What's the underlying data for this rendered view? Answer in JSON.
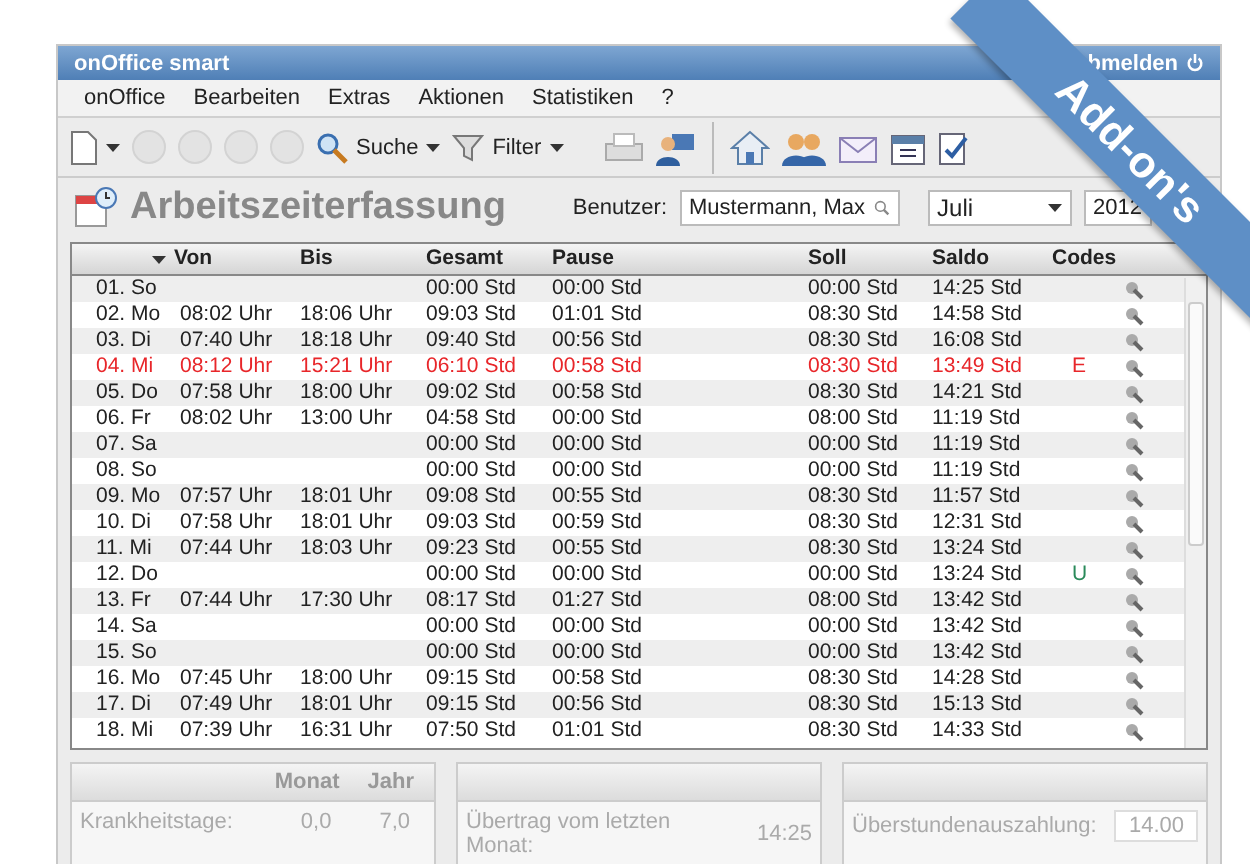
{
  "window": {
    "title": "onOffice smart",
    "logout": "bmelden"
  },
  "menu": [
    "onOffice",
    "Bearbeiten",
    "Extras",
    "Aktionen",
    "Statistiken",
    "?"
  ],
  "toolbar": {
    "search": "Suche",
    "filter": "Filter"
  },
  "header": {
    "title": "Arbeitszeiterfassung",
    "user_label": "Benutzer:",
    "user": "Mustermann, Max",
    "month": "Juli",
    "year": "2012"
  },
  "table": {
    "columns": [
      "Von",
      "Bis",
      "Gesamt",
      "Pause",
      "Soll",
      "Saldo",
      "Codes"
    ],
    "rows": [
      {
        "day": "01. So",
        "von": "",
        "bis": "",
        "gesamt": "00:00 Std",
        "pause": "00:00 Std",
        "soll": "00:00 Std",
        "saldo": "14:25 Std",
        "code": "",
        "highlighted": false
      },
      {
        "day": "02. Mo",
        "von": "08:02 Uhr",
        "bis": "18:06 Uhr",
        "gesamt": "09:03 Std",
        "pause": "01:01 Std",
        "soll": "08:30 Std",
        "saldo": "14:58 Std",
        "code": "",
        "highlighted": false
      },
      {
        "day": "03. Di",
        "von": "07:40 Uhr",
        "bis": "18:18 Uhr",
        "gesamt": "09:40 Std",
        "pause": "00:56 Std",
        "soll": "08:30 Std",
        "saldo": "16:08 Std",
        "code": "",
        "highlighted": false
      },
      {
        "day": "04. Mi",
        "von": "08:12 Uhr",
        "bis": "15:21 Uhr",
        "gesamt": "06:10 Std",
        "pause": "00:58 Std",
        "soll": "08:30 Std",
        "saldo": "13:49 Std",
        "code": "E",
        "highlighted": true
      },
      {
        "day": "05. Do",
        "von": "07:58 Uhr",
        "bis": "18:00 Uhr",
        "gesamt": "09:02 Std",
        "pause": "00:58 Std",
        "soll": "08:30 Std",
        "saldo": "14:21 Std",
        "code": "",
        "highlighted": false
      },
      {
        "day": "06. Fr",
        "von": "08:02 Uhr",
        "bis": "13:00 Uhr",
        "gesamt": "04:58 Std",
        "pause": "00:00 Std",
        "soll": "08:00 Std",
        "saldo": "11:19 Std",
        "code": "",
        "highlighted": false
      },
      {
        "day": "07. Sa",
        "von": "",
        "bis": "",
        "gesamt": "00:00 Std",
        "pause": "00:00 Std",
        "soll": "00:00 Std",
        "saldo": "11:19 Std",
        "code": "",
        "highlighted": false
      },
      {
        "day": "08. So",
        "von": "",
        "bis": "",
        "gesamt": "00:00 Std",
        "pause": "00:00 Std",
        "soll": "00:00 Std",
        "saldo": "11:19 Std",
        "code": "",
        "highlighted": false
      },
      {
        "day": "09. Mo",
        "von": "07:57 Uhr",
        "bis": "18:01 Uhr",
        "gesamt": "09:08 Std",
        "pause": "00:55 Std",
        "soll": "08:30 Std",
        "saldo": "11:57 Std",
        "code": "",
        "highlighted": false
      },
      {
        "day": "10. Di",
        "von": "07:58 Uhr",
        "bis": "18:01 Uhr",
        "gesamt": "09:03 Std",
        "pause": "00:59 Std",
        "soll": "08:30 Std",
        "saldo": "12:31 Std",
        "code": "",
        "highlighted": false
      },
      {
        "day": "11. Mi",
        "von": "07:44 Uhr",
        "bis": "18:03 Uhr",
        "gesamt": "09:23 Std",
        "pause": "00:55 Std",
        "soll": "08:30 Std",
        "saldo": "13:24 Std",
        "code": "",
        "highlighted": false
      },
      {
        "day": "12. Do",
        "von": "",
        "bis": "",
        "gesamt": "00:00 Std",
        "pause": "00:00 Std",
        "soll": "00:00 Std",
        "saldo": "13:24 Std",
        "code": "U",
        "highlighted": false
      },
      {
        "day": "13. Fr",
        "von": "07:44 Uhr",
        "bis": "17:30 Uhr",
        "gesamt": "08:17 Std",
        "pause": "01:27 Std",
        "soll": "08:00 Std",
        "saldo": "13:42 Std",
        "code": "",
        "highlighted": false
      },
      {
        "day": "14. Sa",
        "von": "",
        "bis": "",
        "gesamt": "00:00 Std",
        "pause": "00:00 Std",
        "soll": "00:00 Std",
        "saldo": "13:42 Std",
        "code": "",
        "highlighted": false
      },
      {
        "day": "15. So",
        "von": "",
        "bis": "",
        "gesamt": "00:00 Std",
        "pause": "00:00 Std",
        "soll": "00:00 Std",
        "saldo": "13:42 Std",
        "code": "",
        "highlighted": false
      },
      {
        "day": "16. Mo",
        "von": "07:45 Uhr",
        "bis": "18:00 Uhr",
        "gesamt": "09:15 Std",
        "pause": "00:58 Std",
        "soll": "08:30 Std",
        "saldo": "14:28 Std",
        "code": "",
        "highlighted": false
      },
      {
        "day": "17. Di",
        "von": "07:49 Uhr",
        "bis": "18:01 Uhr",
        "gesamt": "09:15 Std",
        "pause": "00:56 Std",
        "soll": "08:30 Std",
        "saldo": "15:13 Std",
        "code": "",
        "highlighted": false
      },
      {
        "day": "18. Mi",
        "von": "07:39 Uhr",
        "bis": "16:31 Uhr",
        "gesamt": "07:50 Std",
        "pause": "01:01 Std",
        "soll": "08:30 Std",
        "saldo": "14:33 Std",
        "code": "",
        "highlighted": false
      }
    ]
  },
  "summary": {
    "month_header": "Monat",
    "year_header": "Jahr",
    "sick_label": "Krankheitstage:",
    "sick_month": "0,0",
    "sick_year": "7,0",
    "carry_label": "Übertrag vom letzten Monat:",
    "carry_value": "14:25",
    "payout_label": "Überstundenauszahlung:",
    "payout_value": "14.00"
  },
  "ribbon": "Add-on's"
}
